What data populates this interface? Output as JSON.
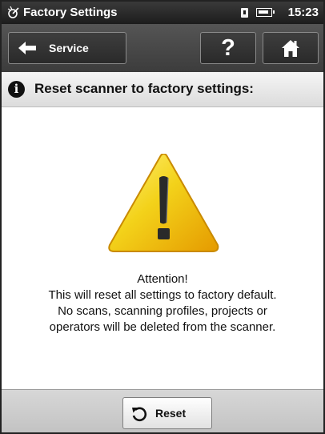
{
  "status_bar": {
    "title": "Factory Settings",
    "time": "15:23",
    "app_icon": "scanner-icon",
    "sd_icon": "sd-card-icon",
    "battery_icon": "battery-icon"
  },
  "toolbar": {
    "back_label": "Service",
    "help_label": "?",
    "back_icon": "back-arrow-icon",
    "home_icon": "home-icon"
  },
  "header": {
    "text": "Reset scanner to factory settings:",
    "icon": "info-icon"
  },
  "content": {
    "warning_icon": "warning-triangle-icon",
    "message_lines": [
      "Attention!",
      "This will reset all settings to factory default.",
      "No scans, scanning profiles, projects or",
      "operators will be deleted from the scanner."
    ]
  },
  "bottom_bar": {
    "reset_label": "Reset",
    "reset_icon": "reset-icon"
  },
  "colors": {
    "status_bar": "#1c1c1c",
    "toolbar": "#4a4a4a",
    "warning_yellow": "#f3d21a",
    "warning_orange": "#e59a00"
  }
}
